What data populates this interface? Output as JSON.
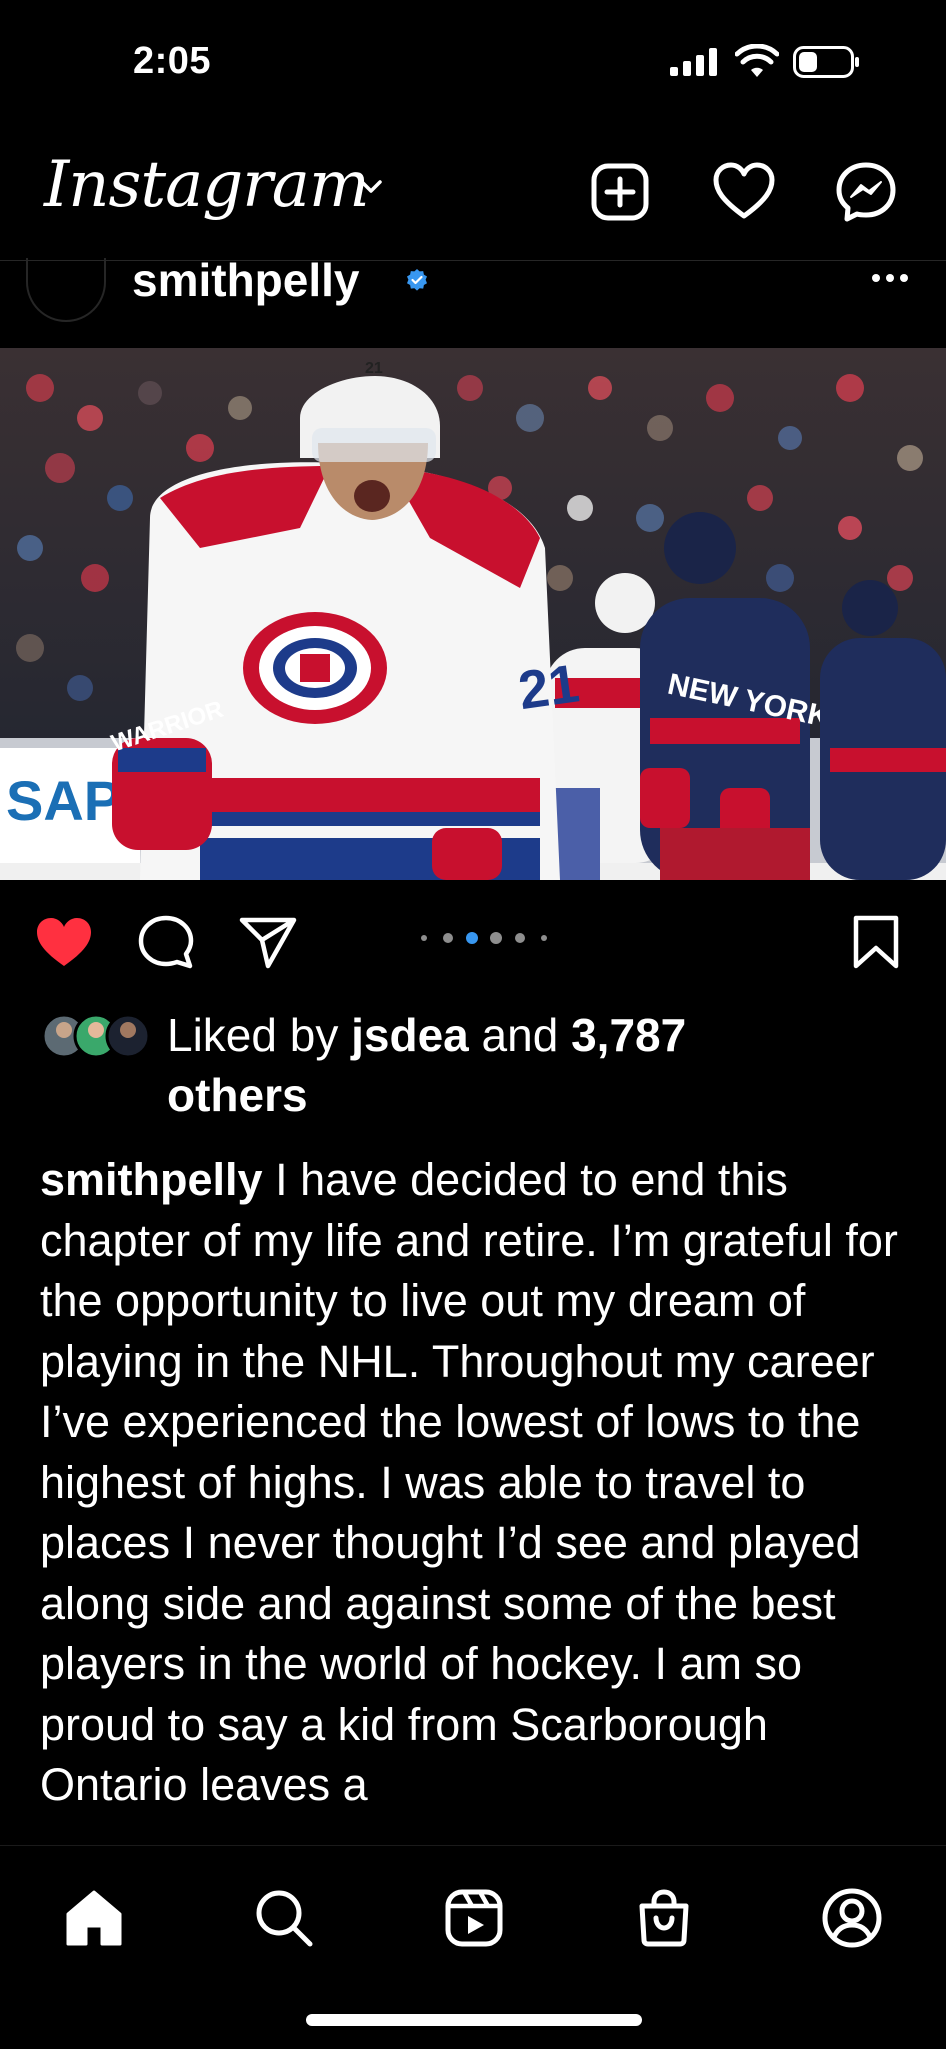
{
  "status_bar": {
    "time": "2:05",
    "battery_level": 0.35
  },
  "header": {
    "logo": "Instagram",
    "icons": [
      "new-post-icon",
      "heart-icon",
      "messenger-icon"
    ]
  },
  "post": {
    "username": "smithpelly",
    "verified": true,
    "carousel": {
      "count": 6,
      "active_index": 2
    },
    "photo": {
      "helmet_number": "21",
      "jersey_number": "21",
      "ad_board_text": "SAP",
      "opponent_text": "NEW YORK",
      "glove_brand": "WARRIOR"
    },
    "likes": {
      "prefix": "Liked by ",
      "user": "jsdea",
      "middle": " and ",
      "count": "3,787",
      "suffix": "others"
    },
    "caption": {
      "username": "smithpelly",
      "text": " I have decided to end this chapter of my life and retire. I’m grateful for the opportunity to live out my dream of playing in the NHL. Throughout my career I’ve experienced the lowest of lows to the highest of highs. I was able to travel to places I never thought I’d see and played along side and against some of the best players in the world of hockey. I am so proud to say a kid from Scarborough Ontario leaves a"
    }
  },
  "tabbar": {
    "items": [
      "home-icon",
      "search-icon",
      "reels-icon",
      "shop-icon",
      "profile-icon"
    ],
    "active": "home-icon"
  },
  "colors": {
    "like_red": "#ff3040",
    "verified_blue": "#3897f0",
    "dot_active": "#3897f0",
    "dot_inactive": "#8e8e8e"
  }
}
